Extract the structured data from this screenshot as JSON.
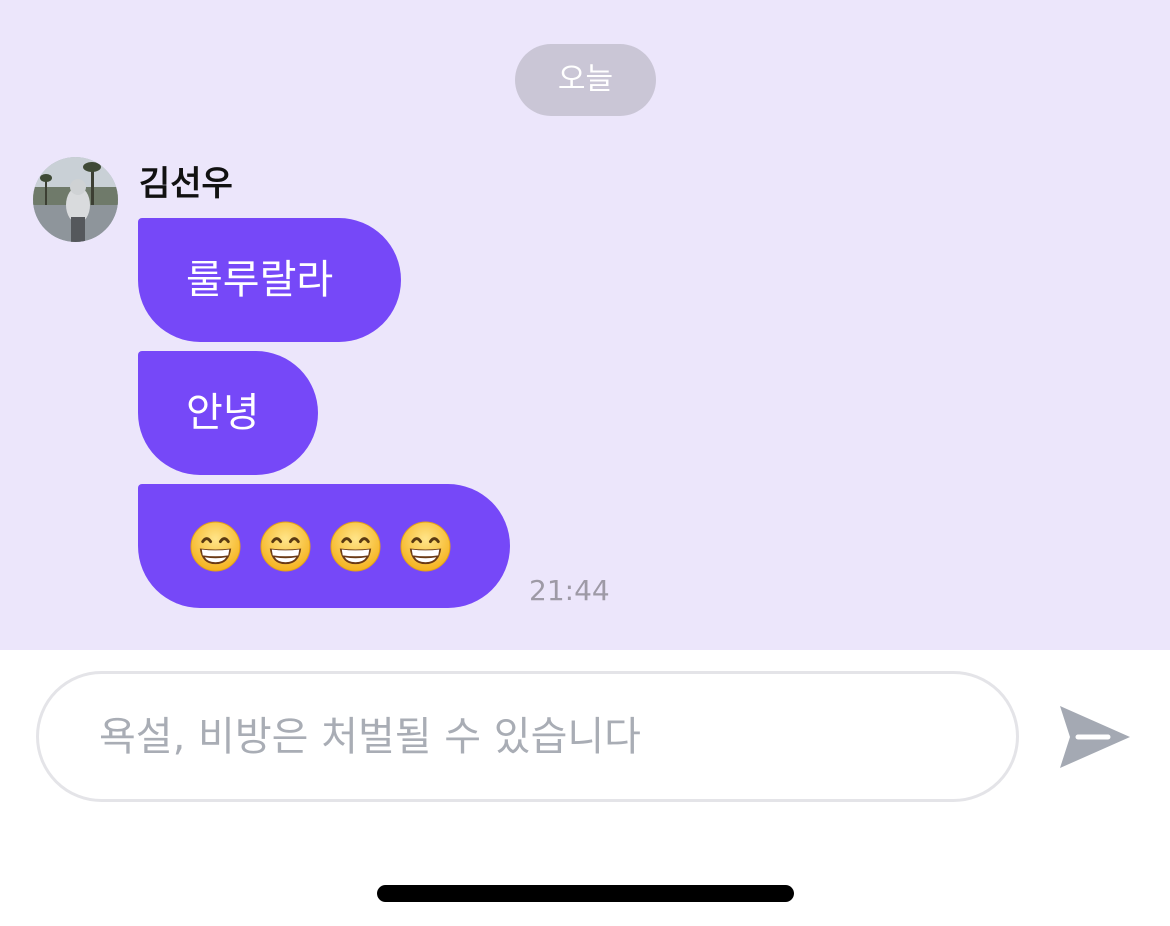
{
  "chat": {
    "date_divider": "오늘",
    "sender": {
      "name": "김선우",
      "avatar_icon": "user-avatar-photo"
    },
    "messages": [
      {
        "text": "룰루랄라"
      },
      {
        "text": "안녕"
      },
      {
        "emojis": [
          "grinning-face-smiling-eyes",
          "grinning-face-smiling-eyes",
          "grinning-face-smiling-eyes",
          "grinning-face-smiling-eyes"
        ],
        "emoji_count": 4
      }
    ],
    "timestamp": "21:44"
  },
  "composer": {
    "placeholder": "욕설, 비방은 처벌될 수 있습니다",
    "value": "",
    "send_icon": "send-icon"
  },
  "colors": {
    "chat_background": "#ECE6FB",
    "bubble": "#7648F8",
    "date_pill": "#CAC6D6",
    "timestamp": "#9E9AA6",
    "send_icon": "#A4A9B3"
  }
}
